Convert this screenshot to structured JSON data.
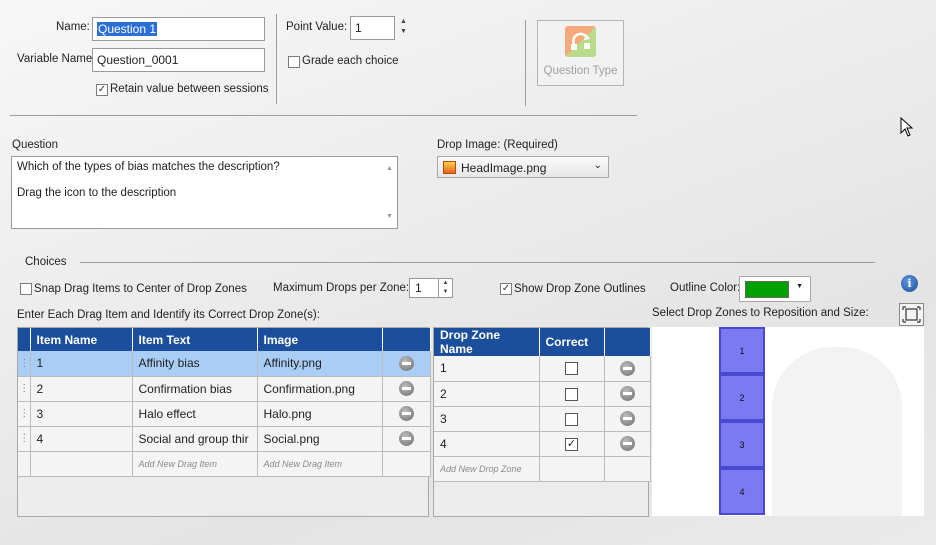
{
  "fields": {
    "name_label": "Name:",
    "name_value": "Question 1",
    "variable_label": "Variable Name:",
    "variable_value": "Question_0001",
    "retain_label": "Retain value between sessions",
    "point_value_label": "Point Value:",
    "point_value": "1",
    "grade_each_label": "Grade each choice",
    "question_type_label": "Question Type"
  },
  "question": {
    "label": "Question",
    "line1": "Which of the types of bias matches the description?",
    "line2": "Drag the icon to the description"
  },
  "drop_image": {
    "label": "Drop Image: (Required)",
    "value": "HeadImage.png"
  },
  "choices": {
    "label": "Choices",
    "snap_label": "Snap Drag Items to Center of Drop Zones",
    "max_drops_label": "Maximum Drops per Zone:",
    "max_drops_value": "1",
    "show_outlines_label": "Show Drop Zone Outlines",
    "outline_color_label": "Outline Color:",
    "outline_color": "#00a000",
    "instruction": "Enter Each Drag Item and Identify its Correct Drop Zone(s):",
    "select_zones_label": "Select Drop Zones to Reposition and Size:"
  },
  "drag_table": {
    "headers": [
      "Item Name",
      "Item Text",
      "Image"
    ],
    "rows": [
      {
        "name": "1",
        "text": "Affinity bias",
        "image": "Affinity.png"
      },
      {
        "name": "2",
        "text": "Confirmation bias",
        "image": "Confirmation.png"
      },
      {
        "name": "3",
        "text": "Halo effect",
        "image": "Halo.png"
      },
      {
        "name": "4",
        "text": "Social and group thir",
        "image": "Social.png"
      }
    ],
    "add_text": "Add New Drag Item",
    "add_image": "Add New Drag Item"
  },
  "zone_table": {
    "headers": [
      "Drop Zone Name",
      "Correct"
    ],
    "rows": [
      {
        "name": "1",
        "correct": false
      },
      {
        "name": "2",
        "correct": false
      },
      {
        "name": "3",
        "correct": false
      },
      {
        "name": "4",
        "correct": true
      }
    ],
    "add_text": "Add New Drop Zone"
  },
  "preview_zones": [
    "1",
    "2",
    "3",
    "4"
  ]
}
